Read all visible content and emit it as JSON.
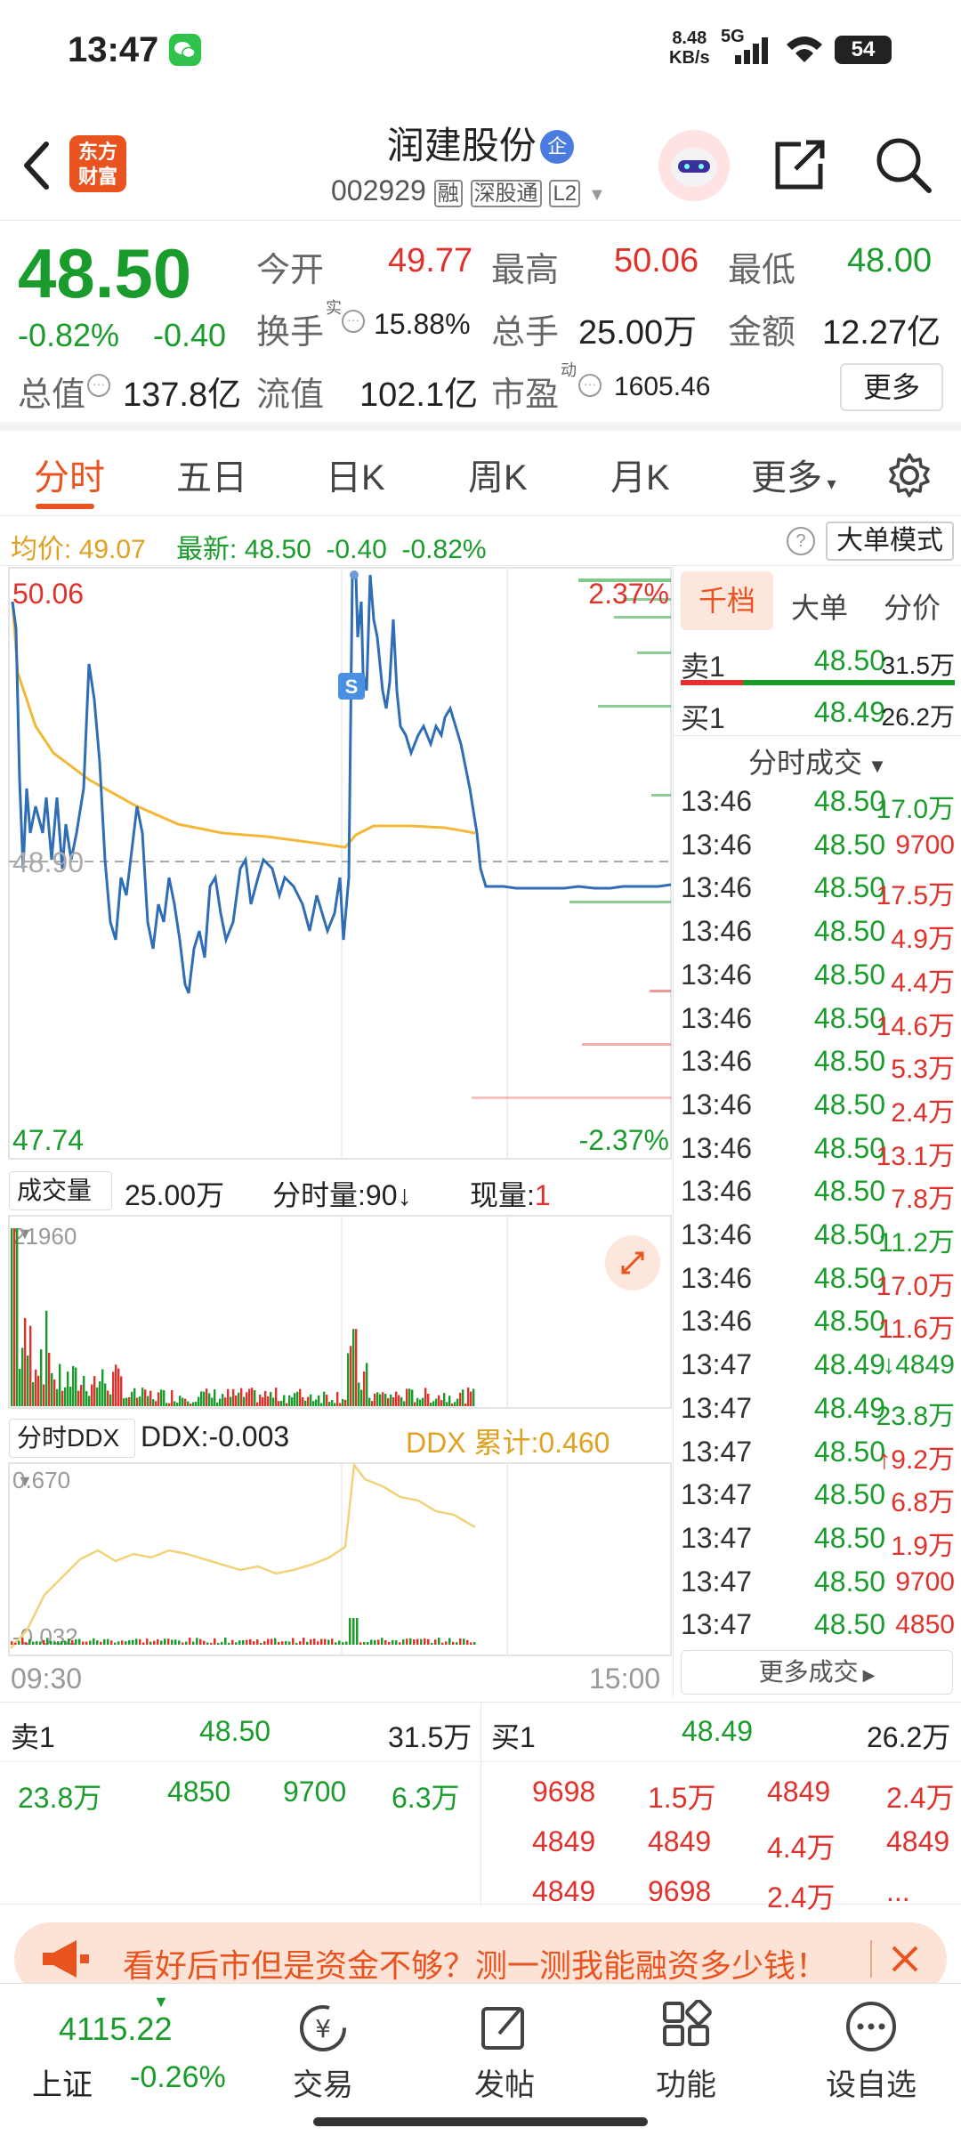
{
  "status_bar": {
    "time": "13:47",
    "net_speed_value": "8.48",
    "net_speed_unit": "KB/s",
    "network": "5G",
    "battery": "54"
  },
  "header": {
    "logo_line1": "东方",
    "logo_line2": "财富",
    "stock_name": "润建股份",
    "tag_qi": "企",
    "code": "002929",
    "badge_rong": "融",
    "badge_sgt": "深股通",
    "badge_l2": "L2"
  },
  "quote": {
    "price": "48.50",
    "change_pct": "-0.82%",
    "change": "-0.40",
    "open_label": "今开",
    "open": "49.77",
    "high_label": "最高",
    "high": "50.06",
    "low_label": "最低",
    "low": "48.00",
    "turnover_label": "换手",
    "turnover_sup": "实",
    "turnover": "15.88%",
    "volume_label": "总手",
    "volume": "25.00万",
    "amount_label": "金额",
    "amount": "12.27亿",
    "mktcap_label": "总值",
    "mktcap": "137.8亿",
    "float_label": "流值",
    "float_cap": "102.1亿",
    "pe_label": "市盈",
    "pe_sup": "动",
    "pe": "1605.46",
    "more_button": "更多"
  },
  "tabs": [
    "分时",
    "五日",
    "日K",
    "周K",
    "月K",
    "更多"
  ],
  "infobar": {
    "avg_label": "均价:",
    "avg": "49.07",
    "latest_label": "最新:",
    "latest": "48.50",
    "latest_change": "-0.40",
    "latest_pct": "-0.82%",
    "mode_button": "大单模式"
  },
  "chart": {
    "price_high": "50.06",
    "price_low": "47.74",
    "pct_high": "2.37%",
    "pct_low": "-2.37%",
    "mid_price": "48.90",
    "marker_s": "S",
    "vol_dropdown": "成交量",
    "vol_total": "25.00万",
    "vol_per_label": "分时量:90",
    "vol_arrow": "↓",
    "vol_now_label": "现量:",
    "vol_now": "1",
    "vol_max": "21960",
    "ddx_dropdown": "分时DDX",
    "ddx_label": "DDX:-0.003",
    "ddx_cum": "DDX 累计:0.460",
    "ddx_max": "0.670",
    "ddx_min": "-0.032",
    "time_start": "09:30",
    "time_end": "15:00",
    "colors": {
      "price_line": "#2f6db5",
      "avg_line": "#f2b83a",
      "up": "#e0312b",
      "down": "#1a9c2c"
    }
  },
  "chart_data": {
    "type": "line",
    "x_range": [
      "09:30",
      "15:00"
    ],
    "ylim": [
      47.74,
      50.06
    ],
    "series": []
  },
  "right_panel": {
    "tabs": [
      "千档",
      "大单",
      "分价"
    ],
    "sell1_label": "卖1",
    "sell1_price": "48.50",
    "sell1_vol": "31.5万",
    "buy1_label": "买1",
    "buy1_price": "48.49",
    "buy1_vol": "26.2万",
    "trades_header": "分时成交",
    "trades": [
      {
        "t": "13:46",
        "p": "48.50",
        "v": "17.0万",
        "c": "green"
      },
      {
        "t": "13:46",
        "p": "48.50",
        "v": "9700",
        "c": "red"
      },
      {
        "t": "13:46",
        "p": "48.50",
        "v": "17.5万",
        "c": "red"
      },
      {
        "t": "13:46",
        "p": "48.50",
        "v": "4.9万",
        "c": "red"
      },
      {
        "t": "13:46",
        "p": "48.50",
        "v": "4.4万",
        "c": "red"
      },
      {
        "t": "13:46",
        "p": "48.50",
        "v": "14.6万",
        "c": "red"
      },
      {
        "t": "13:46",
        "p": "48.50",
        "v": "5.3万",
        "c": "red"
      },
      {
        "t": "13:46",
        "p": "48.50",
        "v": "2.4万",
        "c": "red"
      },
      {
        "t": "13:46",
        "p": "48.50",
        "v": "13.1万",
        "c": "red"
      },
      {
        "t": "13:46",
        "p": "48.50",
        "v": "7.8万",
        "c": "red"
      },
      {
        "t": "13:46",
        "p": "48.50",
        "v": "11.2万",
        "c": "green"
      },
      {
        "t": "13:46",
        "p": "48.50",
        "v": "17.0万",
        "c": "red"
      },
      {
        "t": "13:46",
        "p": "48.50",
        "v": "11.6万",
        "c": "red"
      },
      {
        "t": "13:47",
        "p": "48.49",
        "v": "↓4849",
        "c": "green"
      },
      {
        "t": "13:47",
        "p": "48.49",
        "v": "23.8万",
        "c": "green"
      },
      {
        "t": "13:47",
        "p": "48.50",
        "v": "↑9.2万",
        "c": "red"
      },
      {
        "t": "13:47",
        "p": "48.50",
        "v": "6.8万",
        "c": "red"
      },
      {
        "t": "13:47",
        "p": "48.50",
        "v": "1.9万",
        "c": "red"
      },
      {
        "t": "13:47",
        "p": "48.50",
        "v": "9700",
        "c": "red"
      },
      {
        "t": "13:47",
        "p": "48.50",
        "v": "4850",
        "c": "red"
      }
    ],
    "more_trades": "更多成交"
  },
  "orderbook": {
    "sell_label": "卖1",
    "sell_price": "48.50",
    "sell_vol": "31.5万",
    "buy_label": "买1",
    "buy_price": "48.49",
    "buy_vol": "26.2万",
    "sell_queue": [
      "23.8万",
      "4850",
      "9700",
      "6.3万"
    ],
    "buy_queue": [
      "9698",
      "1.5万",
      "4849",
      "2.4万",
      "4849",
      "4849",
      "4.4万",
      "4849",
      "4849",
      "9698",
      "2.4万",
      "..."
    ]
  },
  "banner": {
    "text": "看好后市但是资金不够？测一测我能融资多少钱！"
  },
  "bottom_nav": {
    "index_value": "4115.22",
    "index_name": "上证",
    "index_change": "-0.26%",
    "items": [
      "交易",
      "发帖",
      "功能",
      "设自选"
    ]
  }
}
